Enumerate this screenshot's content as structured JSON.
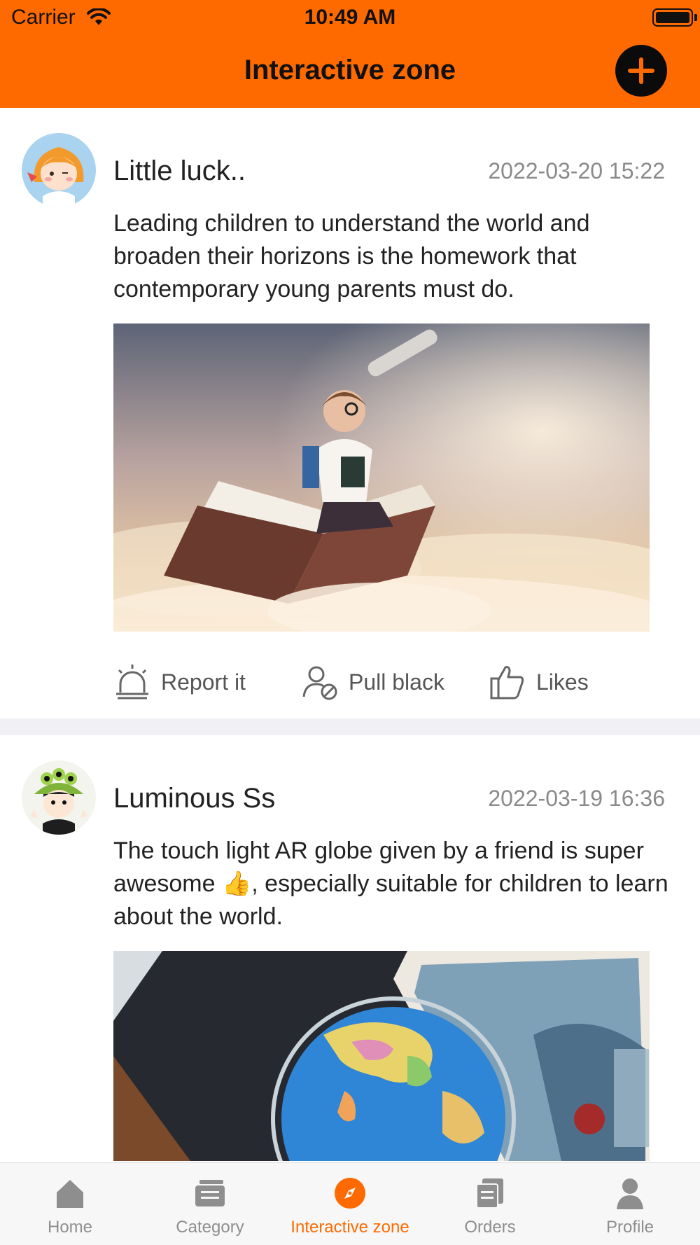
{
  "status_bar": {
    "carrier": "Carrier",
    "time": "10:49 AM"
  },
  "header": {
    "title": "Interactive zone",
    "add_icon": "plus-circle-icon"
  },
  "colors": {
    "accent": "#ff6a00",
    "tab_inactive": "#8e8e8e",
    "separator": "#f1f1f5"
  },
  "posts": [
    {
      "username": "Little luck..",
      "timestamp": "2022-03-20 15:22",
      "content": "Leading children to understand the world and broaden their horizons is the homework that contemporary young parents must do.",
      "photo": "girl-with-telescope-on-flying-book"
    },
    {
      "username": "Luminous Ss",
      "timestamp": "2022-03-19 16:36",
      "content": "The touch light AR globe given by a friend is super awesome 👍, especially suitable for children to learn about the world.",
      "photo": "ar-globe-on-desk"
    }
  ],
  "actions": {
    "report": "Report it",
    "pull_black": "Pull black",
    "likes": "Likes"
  },
  "tabs": [
    {
      "label": "Home",
      "icon": "home-icon"
    },
    {
      "label": "Category",
      "icon": "category-icon"
    },
    {
      "label": "Interactive zone",
      "icon": "compass-icon",
      "active": true
    },
    {
      "label": "Orders",
      "icon": "orders-icon"
    },
    {
      "label": "Profile",
      "icon": "profile-icon"
    }
  ]
}
